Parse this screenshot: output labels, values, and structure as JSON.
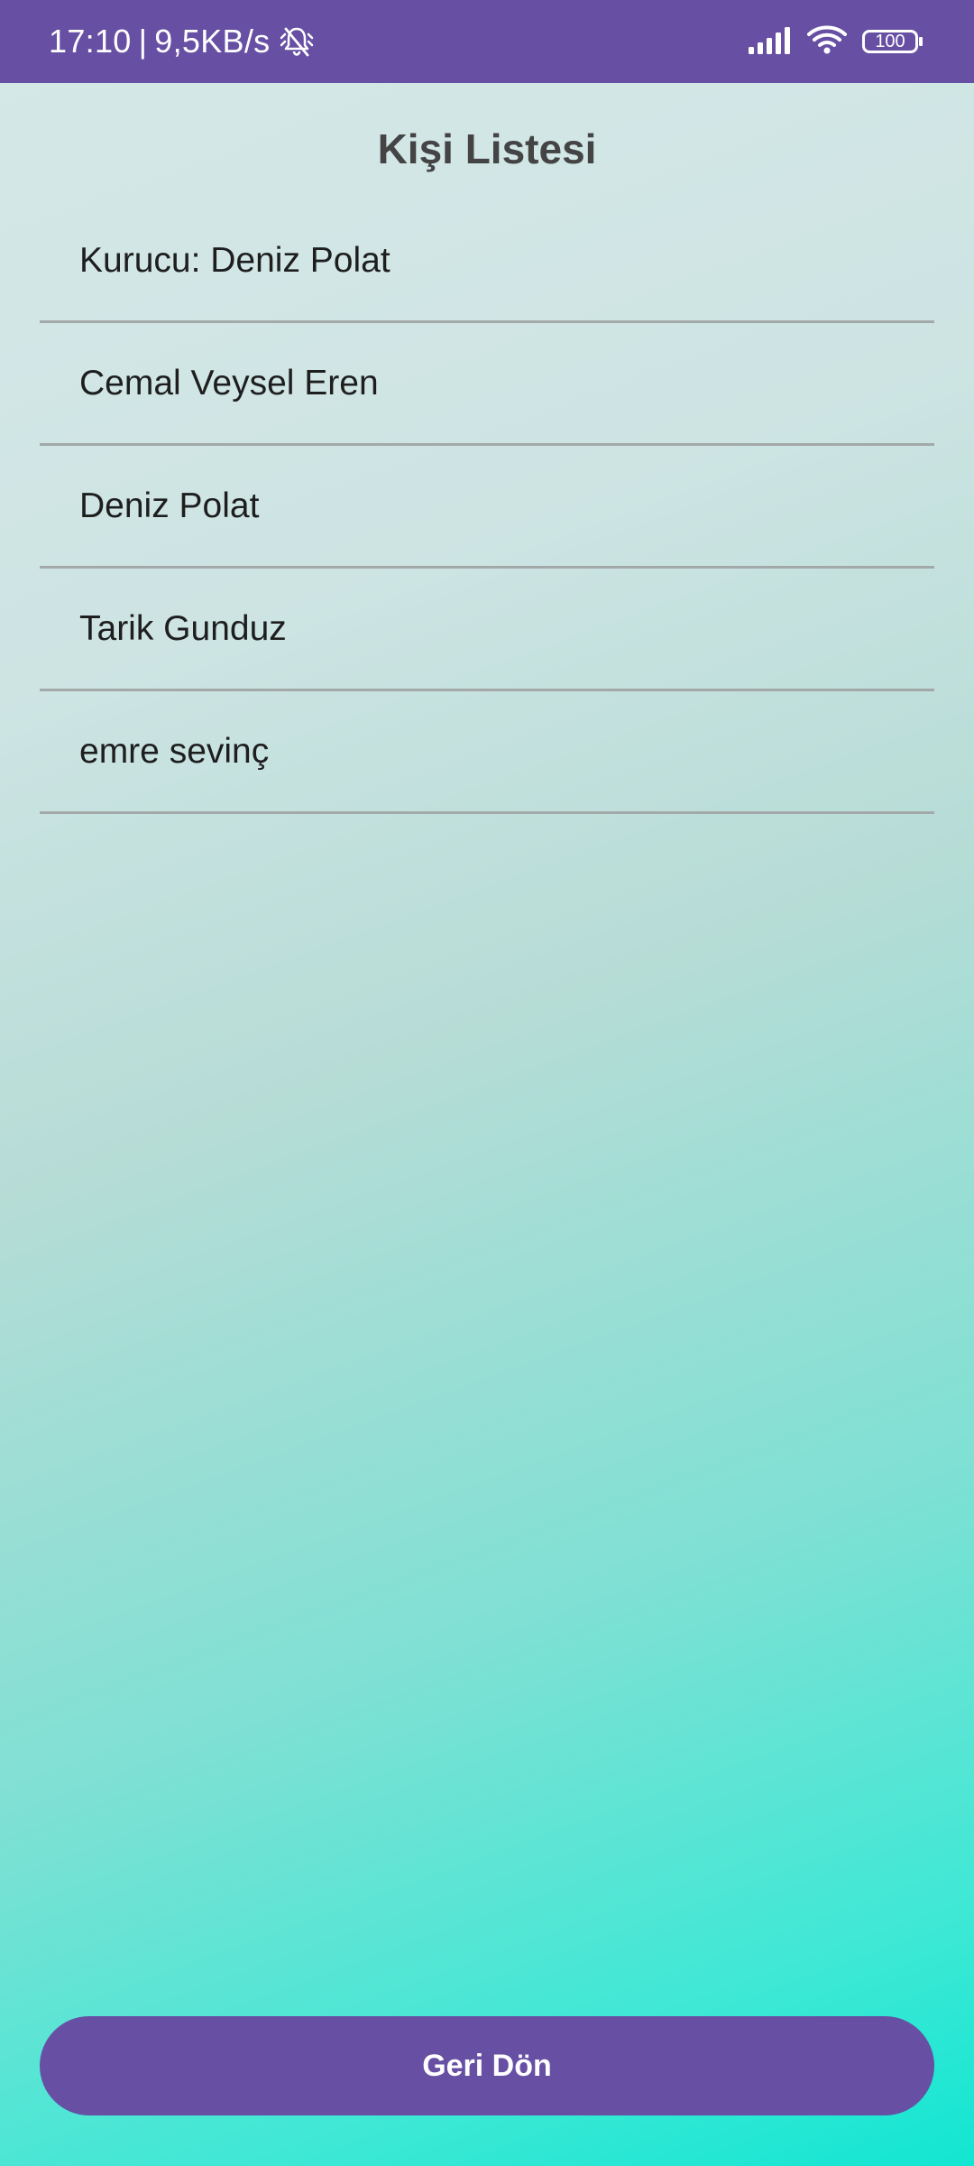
{
  "status_bar": {
    "time": "17:10",
    "separator": "|",
    "network_speed": "9,5KB/s",
    "icons": [
      "bell-off-icon",
      "signal-icon",
      "wifi-icon",
      "battery-icon"
    ],
    "battery_level": "100",
    "background_color": "#6750a4"
  },
  "screen": {
    "title": "Kişi Listesi"
  },
  "people": [
    "Kurucu: Deniz Polat",
    "Cemal Veysel Eren",
    "Deniz Polat",
    "Tarik Gunduz",
    "emre sevinç"
  ],
  "back_button": {
    "label": "Geri Dön",
    "color": "#6750a4"
  }
}
